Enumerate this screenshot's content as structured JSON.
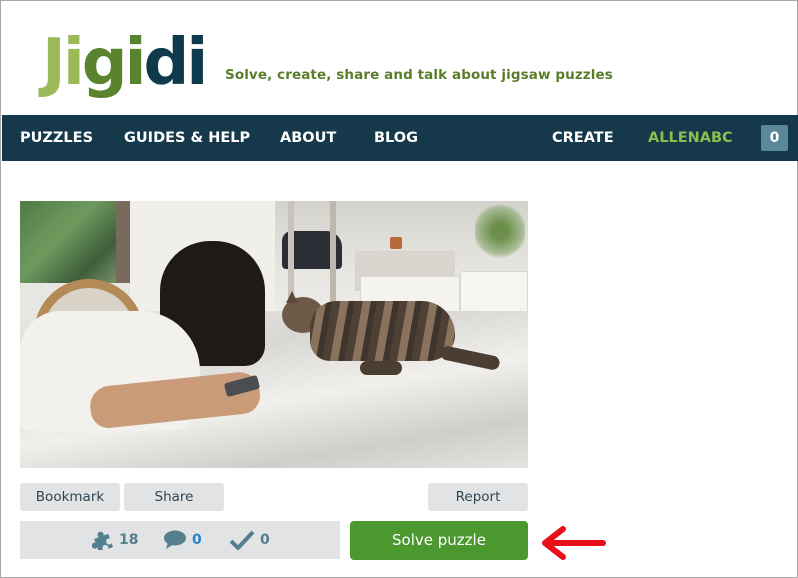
{
  "header": {
    "logo_parts": [
      "Ji",
      "gi",
      "di"
    ],
    "tagline": "Solve, create, share and talk about jigsaw puzzles"
  },
  "nav": {
    "items": [
      {
        "label": "PUZZLES"
      },
      {
        "label": "GUIDES & HELP"
      },
      {
        "label": "ABOUT"
      },
      {
        "label": "BLOG"
      }
    ],
    "create_label": "CREATE",
    "username": "ALLENABC",
    "notification_count": "0"
  },
  "puzzle": {
    "image_description": "Girl lying on a marble table looking at a phone beside a tabby cat",
    "actions": {
      "bookmark_label": "Bookmark",
      "share_label": "Share",
      "report_label": "Report"
    },
    "stats": {
      "pieces": "18",
      "comments": "0",
      "solves": "0"
    },
    "solve_label": "Solve puzzle"
  },
  "colors": {
    "nav_bg": "#15394b",
    "solve_button": "#4a982e",
    "username": "#8cbf4f",
    "annotation_arrow": "#e8111a"
  }
}
